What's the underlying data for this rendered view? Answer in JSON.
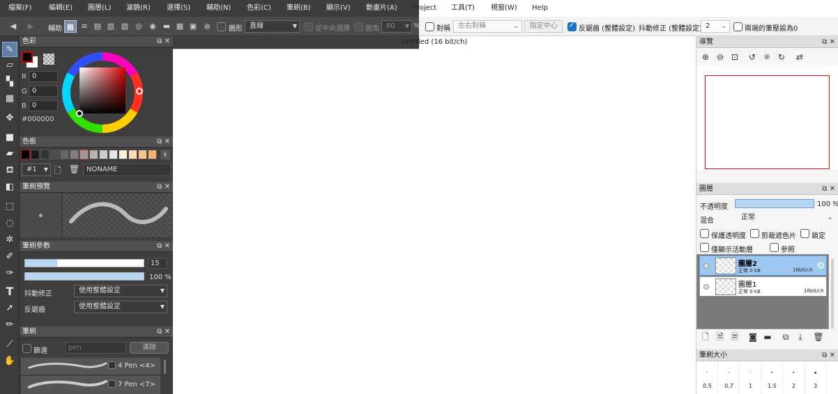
{
  "menu": {
    "dark_items": [
      "檔案(F)",
      "編輯(E)",
      "圖層(L)",
      "濾鏡(R)",
      "選擇(S)",
      "輔助(N)",
      "色彩(C)",
      "筆刷(B)",
      "顯示(V)",
      "動畫片(A)"
    ],
    "light_items": [
      "Project",
      "工具(T)",
      "視窗(W)",
      "Help"
    ]
  },
  "toolbar": {
    "assist_label": "輔助",
    "shape_label": "圓形",
    "line_value": "直線",
    "from_center_label": "從中央選擇",
    "corner_label": "圓角",
    "corner_value": "80",
    "percent": "%",
    "symmetry_label": "對稱",
    "symmetry_value": "左右對稱",
    "set_center_label": "指定中心",
    "antialias_label": "反鋸齒 (整體設定)",
    "stab_label": "抖動修正 (整體設定)",
    "stab_value": "2",
    "pressure_label": "兩端的筆壓設為0"
  },
  "color_panel": {
    "title": "色彩",
    "r_label": "R",
    "r_value": "0",
    "g_label": "G",
    "g_value": "0",
    "b_label": "B",
    "b_value": "0",
    "hex": "#000000"
  },
  "palette_panel": {
    "title": "色板",
    "index": "#1",
    "name": "NONAME",
    "swatches": [
      "#000000",
      "#1a1a1a",
      "#333333",
      "#4d4d4d",
      "#666666",
      "#808080",
      "#999999",
      "#b3b3b3",
      "#cccccc",
      "#e6e6e6",
      "#fff0d8",
      "#fcdcb0",
      "#f8c58c",
      "#f5b070"
    ]
  },
  "brush_preview": {
    "title": "筆刷預覽"
  },
  "brush_params": {
    "title": "筆刷參數",
    "size_value": "15",
    "opacity_value": "100 %",
    "size_fraction": 0.27,
    "opacity_fraction": 1.0,
    "stab_label": "抖動修正",
    "stab_value": "使用整體設定",
    "aa_label": "反鋸齒",
    "aa_value": "使用整體設定"
  },
  "brush_panel": {
    "title": "筆刷",
    "filter_label": "篩選",
    "filter_placeholder": "pen",
    "clear_label": "清除",
    "items": [
      "4 Pen <4>",
      "7 Pen <7>"
    ]
  },
  "canvas": {
    "title": "Untitled  (16 bit/ch)"
  },
  "navigator": {
    "title": "導覽"
  },
  "layers_panel": {
    "title": "圖層",
    "opacity_label": "不透明度",
    "opacity_value": "100 %",
    "opacity_fraction": 1.0,
    "blend_label": "混合",
    "blend_value": "正常",
    "protect_alpha": "保護透明度",
    "clipping": "剪裁遮色片",
    "lock": "鎖定",
    "only_active": "僅顯示活動層",
    "reference": "參照",
    "layers": [
      {
        "name": "圖層2",
        "info": "正常 0 kB",
        "depth": "16bit/ch",
        "selected": true
      },
      {
        "name": "圖層1",
        "info": "正常 0 kB",
        "depth": "16bit/ch",
        "selected": false
      }
    ]
  },
  "brush_size_panel": {
    "title": "筆刷大小",
    "sizes": [
      "0.5",
      "0.7",
      "1",
      "1.5",
      "2",
      "3"
    ]
  },
  "icons": {
    "tools": [
      "brush-icon",
      "eraser-icon",
      "dot-icon",
      "fill-grid-icon",
      "move-icon",
      "rect-fill-icon",
      "gradient-shape-icon",
      "bucket-icon",
      "gradient-icon",
      "rect-select-icon",
      "lasso-icon",
      "magic-wand-icon",
      "select-pen-icon",
      "select-eraser-icon",
      "text-icon",
      "operation-icon",
      "divider-pen-icon",
      "eyedropper-icon",
      "hand-icon"
    ]
  },
  "colors": {
    "accent": "#5b9bd5",
    "dark_bg": "#3e3e3e",
    "nav_frame": "#e01010"
  }
}
